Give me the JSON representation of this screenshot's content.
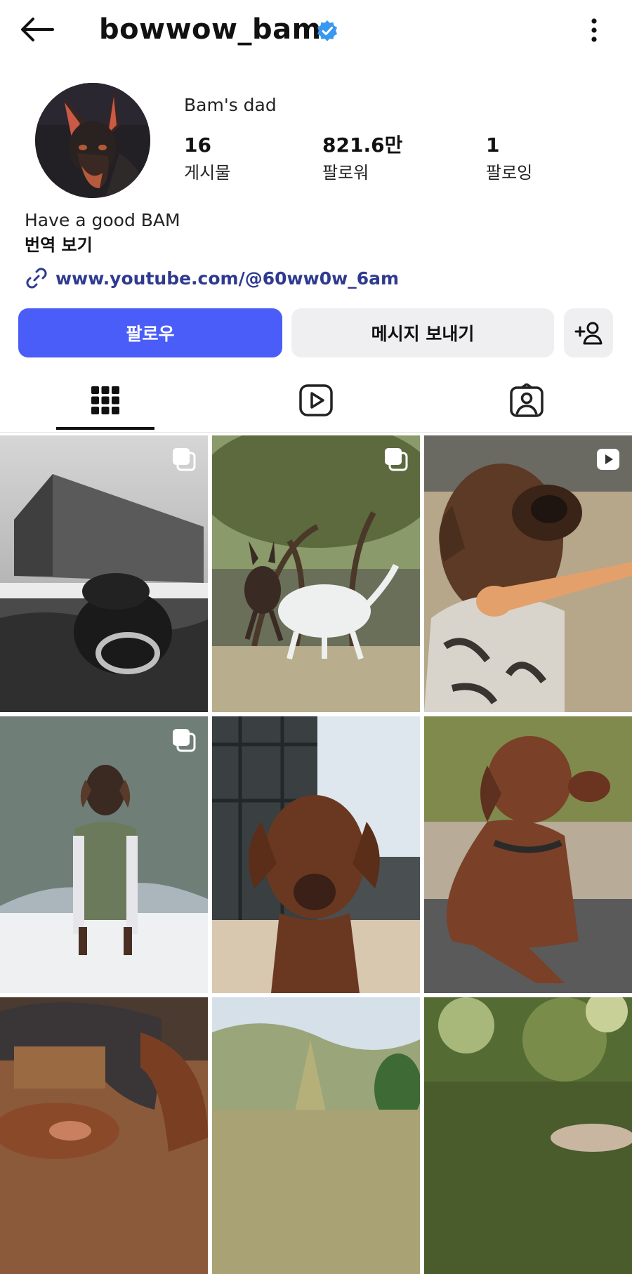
{
  "header": {
    "username": "bowwow_bam",
    "back_icon": "arrow-left-icon",
    "verified_icon": "verified-badge-icon",
    "more_icon": "more-vertical-icon"
  },
  "profile": {
    "display_name": "Bam's dad",
    "stats": [
      {
        "value": "16",
        "label": "게시물"
      },
      {
        "value": "821.6만",
        "label": "팔로워"
      },
      {
        "value": "1",
        "label": "팔로잉"
      }
    ],
    "bio": "Have a good BAM",
    "translate_label": "번역 보기",
    "link_icon": "link-icon",
    "link": "www.youtube.com/@60ww0w_6am"
  },
  "actions": {
    "follow_label": "팔로우",
    "message_label": "메시지 보내기",
    "add_user_icon": "add-user-icon"
  },
  "tabs": [
    {
      "name": "posts",
      "icon": "grid-icon",
      "active": true
    },
    {
      "name": "reels",
      "icon": "reels-icon",
      "active": false
    },
    {
      "name": "tagged",
      "icon": "tagged-person-icon",
      "active": false
    }
  ],
  "colors": {
    "accent": "#4a5df9",
    "verified": "#3897f0",
    "link": "#2f3a8f",
    "secondary_button": "#efeff2"
  },
  "posts": [
    {
      "subject": "doberman swimming in pool, black and white",
      "badge": "carousel-icon"
    },
    {
      "subject": "doberman playing with white dog under tree",
      "badge": "carousel-icon"
    },
    {
      "subject": "doberman chewing toy bone in camo sweater",
      "badge": "reel-icon"
    },
    {
      "subject": "doberman in green vest in snow",
      "badge": "carousel-icon"
    },
    {
      "subject": "doberman portrait by glass building",
      "badge": ""
    },
    {
      "subject": "doberman lying on deck with collar",
      "badge": ""
    },
    {
      "subject": "doberman belly rub on bench",
      "badge": ""
    },
    {
      "subject": "hillside trees landscape",
      "badge": ""
    },
    {
      "subject": "blurred green garden",
      "badge": ""
    }
  ]
}
